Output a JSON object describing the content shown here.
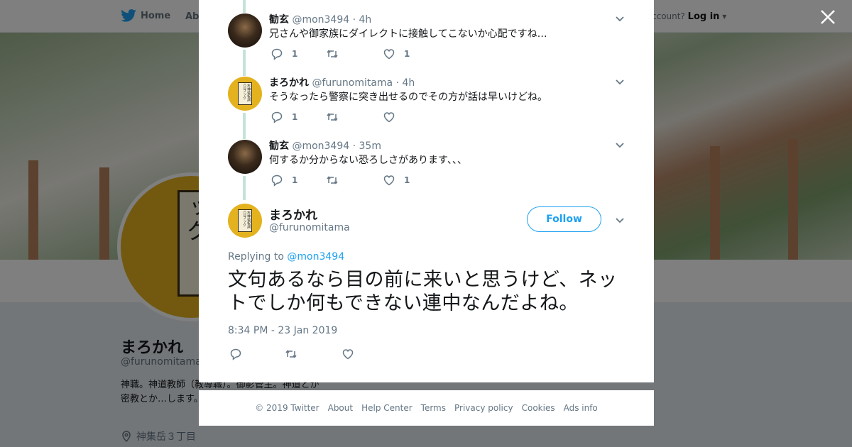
{
  "nav": {
    "home_label": "Home",
    "about_label": "Abo",
    "account_prompt": "ccount?",
    "login_label": "Log in"
  },
  "profile": {
    "name": "まろかれ",
    "handle": "@furunomitama",
    "bio": "神職。神道教師（教導職）。御影管主。神道とか密教とか…します。",
    "location": "神集岳３丁目",
    "avatar_text": "古神道祝詞CDブック"
  },
  "thread": [
    {
      "name": "勧玄",
      "handle": "@mon3494",
      "time": "· 4h",
      "text": "兄さんや御家族にダイレクトに接触してこないか心配ですね…",
      "reply_count": "1",
      "retweet_count": "",
      "like_count": "1",
      "avatar": "dark-portrait"
    },
    {
      "name": "まろかれ",
      "handle": "@furunomitama",
      "time": "· 4h",
      "text": "そうなったら警察に突き出せるのでその方が話は早いけどね。",
      "reply_count": "1",
      "retweet_count": "",
      "like_count": "",
      "avatar": "yellow-book"
    },
    {
      "name": "勧玄",
      "handle": "@mon3494",
      "time": "· 35m",
      "text": "何するか分からない恐ろしさがあります、、、",
      "reply_count": "1",
      "retweet_count": "",
      "like_count": "1",
      "avatar": "dark-portrait"
    }
  ],
  "main_tweet": {
    "name": "まろかれ",
    "handle": "@furunomitama",
    "follow_label": "Follow",
    "replying_prefix": "Replying to",
    "replying_handle": "@mon3494",
    "text": "文句あるなら目の前に来いと思うけど、ネットでしか何もできない連中なんだよね。",
    "timestamp": "8:34 PM - 23 Jan 2019"
  },
  "footer": {
    "copyright": "© 2019 Twitter",
    "links": [
      "About",
      "Help Center",
      "Terms",
      "Privacy policy",
      "Cookies",
      "Ads info"
    ]
  },
  "colors": {
    "accent": "#1da1f2",
    "thread_line": "#c4e3d6",
    "muted_text": "#657786",
    "overlay": "rgba(0,0,0,0.5)"
  },
  "icons": [
    "twitter-bird-icon",
    "chevron-down-icon",
    "reply-icon",
    "retweet-icon",
    "like-icon",
    "close-icon",
    "location-pin-icon"
  ]
}
